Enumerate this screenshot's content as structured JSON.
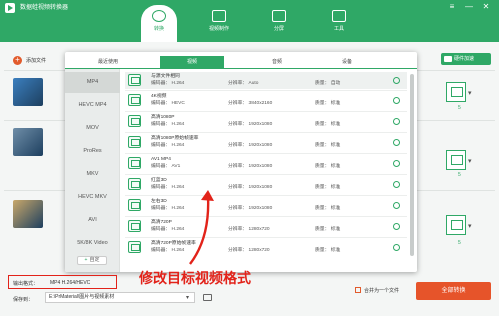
{
  "app": {
    "title": "数据蛙视频转换器"
  },
  "window_controls": [
    "≡",
    "—",
    "✕"
  ],
  "nav_tabs": [
    {
      "label": "转换",
      "active": true
    },
    {
      "label": "视频制作",
      "active": false
    },
    {
      "label": "分屏",
      "active": false
    },
    {
      "label": "工具",
      "active": false
    }
  ],
  "toolbar": {
    "add_files": "添加文件",
    "hw_accel": "硬件加速"
  },
  "file_rows": [
    {
      "count": "5",
      "thumb_color": "#3b7fbf"
    },
    {
      "count": "5",
      "thumb_color": "#6f8ea8"
    },
    {
      "count": "5",
      "thumb_color": "#c9a86a"
    }
  ],
  "panel": {
    "category_tabs": [
      {
        "label": "最近使用",
        "active": false
      },
      {
        "label": "视频",
        "active": true
      },
      {
        "label": "音频",
        "active": false
      },
      {
        "label": "设备",
        "active": false
      }
    ],
    "formats": [
      {
        "label": "MP4",
        "active": true
      },
      {
        "label": "HEVC MP4",
        "active": false
      },
      {
        "label": "MOV",
        "active": false
      },
      {
        "label": "ProRes",
        "active": false
      },
      {
        "label": "MKV",
        "active": false
      },
      {
        "label": "HEVC MKV",
        "active": false
      },
      {
        "label": "AVI",
        "active": false
      },
      {
        "label": "5K/8K Video",
        "active": false
      }
    ],
    "custom_button": "自定",
    "presets": [
      {
        "name": "与源文件相同",
        "codec": "编码器： H.264",
        "resolution": "分辨率： Auto",
        "quality": "质量： 自动"
      },
      {
        "name": "4K视频",
        "codec": "编码器： HEVC",
        "resolution": "分辨率： 3840x2160",
        "quality": "质量： 标准"
      },
      {
        "name": "高清1080P",
        "codec": "编码器： H.264",
        "resolution": "分辨率： 1920x1080",
        "quality": "质量： 标准"
      },
      {
        "name": "高清1080P原始帧速率",
        "codec": "编码器： H.264",
        "resolution": "分辨率： 1920x1080",
        "quality": "质量： 标准"
      },
      {
        "name": "AV1 MP4",
        "codec": "编码器： AV1",
        "resolution": "分辨率： 1920x1080",
        "quality": "质量： 标准"
      },
      {
        "name": "红蓝3D",
        "codec": "编码器： H.264",
        "resolution": "分辨率： 1920x1080",
        "quality": "质量： 标准"
      },
      {
        "name": "左右3D",
        "codec": "编码器： H.264",
        "resolution": "分辨率： 1920x1080",
        "quality": "质量： 标准"
      },
      {
        "name": "高清720P",
        "codec": "编码器： H.264",
        "resolution": "分辨率： 1280x720",
        "quality": "质量： 标准"
      },
      {
        "name": "高清720P原始帧速率",
        "codec": "编码器： H.264",
        "resolution": "分辨率： 1280x720",
        "quality": "质量： 标准"
      }
    ]
  },
  "bottom": {
    "output_format_label": "输出格式：",
    "output_format_value": "MP4 H.264/HEVC",
    "save_to_label": "保存到：",
    "save_path": "E:\\PrMaterial\\图片与视频素材",
    "merge_label": "合并为一个文件",
    "convert_all": "全部转换"
  },
  "annotation": {
    "text": "修改目标视频格式",
    "color": "#e2231a"
  },
  "colors": {
    "brand": "#2fa866",
    "accent": "#e6542a"
  }
}
